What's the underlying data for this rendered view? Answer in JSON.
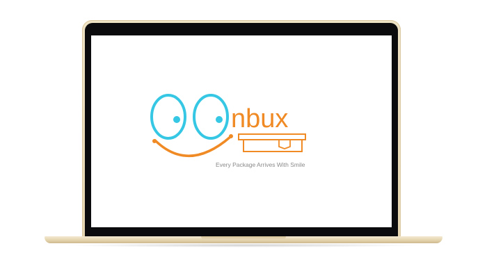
{
  "brand": {
    "wordmark": "nbux",
    "tagline": "Every Package Arrives With Smile"
  },
  "icons": {
    "eyes": "cartoon-eyes-icon",
    "smile": "smile-curve-icon",
    "package": "package-box-icon"
  },
  "colors": {
    "eye_outline": "#35c7e3",
    "pupil": "#35c7e3",
    "orange": "#f08a24",
    "tagline": "#8a8a8a",
    "frame_gold": "#e8d9b5",
    "bezel": "#0b0b0d"
  }
}
